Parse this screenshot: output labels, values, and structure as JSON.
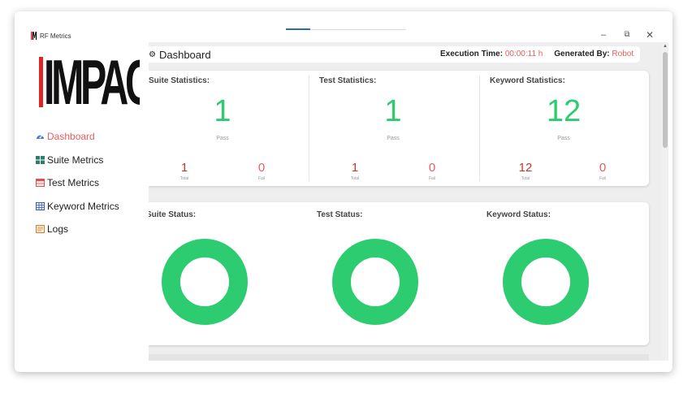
{
  "window": {
    "app_title": "RF Metrics"
  },
  "logo": {
    "text": "IMPACTO"
  },
  "sidebar": {
    "items": [
      {
        "label": "Dashboard",
        "icon": "dashboard-gauge-icon",
        "active": true
      },
      {
        "label": "Suite Metrics",
        "icon": "grid-icon",
        "active": false
      },
      {
        "label": "Test Metrics",
        "icon": "table-icon",
        "active": false
      },
      {
        "label": "Keyword Metrics",
        "icon": "table-grid-icon",
        "active": false
      },
      {
        "label": "Logs",
        "icon": "log-file-icon",
        "active": false
      }
    ]
  },
  "header": {
    "title": "Dashboard",
    "execution_time_label": "Execution Time:",
    "execution_time_value": "00:00:11 h",
    "generated_by_label": "Generated By:",
    "generated_by_value": "Robot"
  },
  "stats": [
    {
      "title": "Suite Statistics:",
      "pass": "1",
      "pass_label": "Pass",
      "total": "1",
      "total_label": "Total",
      "fail": "0",
      "fail_label": "Fail"
    },
    {
      "title": "Test Statistics:",
      "pass": "1",
      "pass_label": "Pass",
      "total": "1",
      "total_label": "Total",
      "fail": "0",
      "fail_label": "Fail"
    },
    {
      "title": "Keyword Statistics:",
      "pass": "12",
      "pass_label": "Pass",
      "total": "12",
      "total_label": "Total",
      "fail": "0",
      "fail_label": "Fail"
    }
  ],
  "status": [
    {
      "title": "Suite Status:",
      "pass_fraction": 1.0
    },
    {
      "title": "Test Status:",
      "pass_fraction": 1.0
    },
    {
      "title": "Keyword Status:",
      "pass_fraction": 1.0
    }
  ],
  "colors": {
    "pass": "#2ecc71",
    "fail": "#e85d5d",
    "accent": "#e85d5d",
    "total": "#c0392b"
  }
}
